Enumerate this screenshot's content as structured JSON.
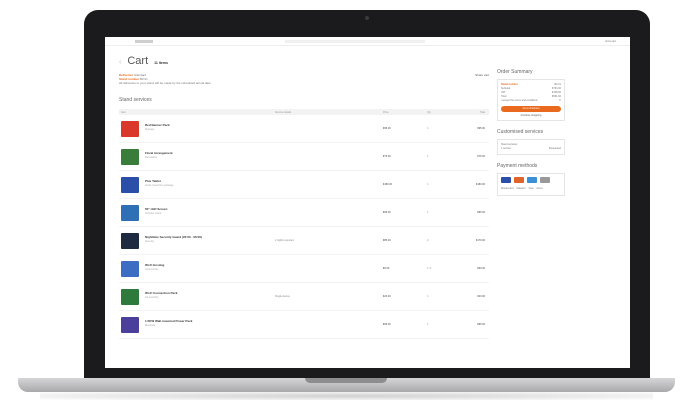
{
  "screen": {
    "topbar_right": "Account",
    "back_icon": "chevron-left-icon",
    "cart_title": "Cart",
    "cart_count": "11 items",
    "info_line1_label": "Deliveries",
    "info_line1_value": "Standard",
    "info_line2_label": "Stand number",
    "info_line2_value": "B2.01",
    "info_line3": "All deliveries to your stand will be made by the scheduled arrival date",
    "share_label": "Share cart",
    "section_title": "Stand services",
    "table_headers": [
      "Item",
      "Service details",
      "Price",
      "Qty",
      "Total"
    ],
    "items": [
      {
        "name": "Red Banner Pack",
        "sub": "Signage",
        "note": "",
        "price": "€95.00",
        "qty": "1",
        "total": "€95.00",
        "color": "#d9382a"
      },
      {
        "name": "Floral Arrangement",
        "sub": "Decoration",
        "note": "",
        "price": "€75.00",
        "qty": "1",
        "total": "€75.00",
        "color": "#3a7d3a"
      },
      {
        "name": "Plus Tablet",
        "sub": "Audio visual hire package",
        "note": "",
        "price": "€180.00",
        "qty": "1",
        "total": "€180.00",
        "color": "#2b4fa8"
      },
      {
        "name": "50\" LED Screen",
        "sub": "Includes stand",
        "note": "",
        "price": "€95.00",
        "qty": "1",
        "total": "€95.00",
        "color": "#2f6fb6"
      },
      {
        "name": "Nighttime Security Guard (22:00 - 06:00)",
        "sub": "Security",
        "note": "2 nights required",
        "price": "€85.00",
        "qty": "2",
        "total": "€170.00",
        "color": "#1e2a40"
      },
      {
        "name": "Wi-Fi Hosting",
        "sub": "Connectivity",
        "note": "",
        "price": "€6.00",
        "qty": "10",
        "total": "€60.00",
        "color": "#3b6dc2"
      },
      {
        "name": "Wi-Fi Connection Pack",
        "sub": "Connectivity",
        "note": "Single device",
        "price": "€23.00",
        "qty": "1",
        "total": "€23.00",
        "color": "#2e7a3c"
      },
      {
        "name": "1.5KW Wall-mounted Power Pack",
        "sub": "Electrical",
        "note": "",
        "price": "€95.00",
        "qty": "1",
        "total": "€95.00",
        "color": "#4a3f9b"
      }
    ],
    "summary": {
      "title": "Order Summary",
      "line1_label": "Stand number",
      "line1_value": "B2.01",
      "line2_label": "Subtotal",
      "line2_value": "€793.00",
      "line3_label": "VAT",
      "line3_value": "€158.60",
      "line4_label": "Total",
      "line4_value": "€951.60",
      "terms": "I accept the terms and conditions",
      "checkout_label": "Go to checkout",
      "continue_label": "Continue shopping"
    },
    "customised": {
      "title": "Customised services",
      "line1": "Stand services",
      "line2_label": "1 service",
      "line2_value": "Requested"
    },
    "payment": {
      "title": "Payment methods",
      "cards": [
        "#2b4fa8",
        "#e0642a",
        "#3a8fd6",
        "#999999"
      ],
      "wallets": [
        "Mastercard",
        "Maestro",
        "Visa",
        "Amex"
      ]
    }
  }
}
